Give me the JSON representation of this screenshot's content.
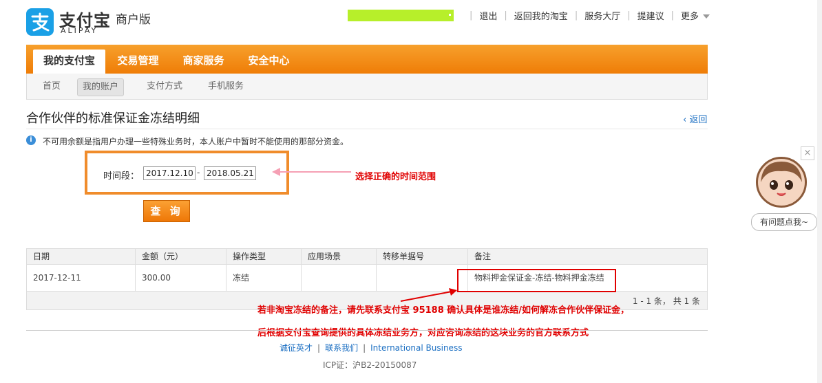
{
  "header": {
    "logo_cn": "支付宝",
    "logo_en": "ALIPAY",
    "logo_sub": "商户版",
    "links": [
      "退出",
      "返回我的淘宝",
      "服务大厅",
      "提建议",
      "更多"
    ]
  },
  "nav": {
    "main_tabs": [
      "我的支付宝",
      "交易管理",
      "商家服务",
      "安全中心"
    ],
    "sub_tabs": [
      "首页",
      "我的账户",
      "支付方式",
      "手机服务"
    ]
  },
  "page": {
    "title": "合作伙伴的标准保证金冻结明细",
    "back": "返回",
    "info": "不可用余额是指用户办理一些特殊业务时，本人账户中暂时不能使用的那部分资金。",
    "range_label": "时间段：",
    "date_from": "2017.12.10",
    "date_sep": "-",
    "date_to": "2018.05.21",
    "query_label": "查 询"
  },
  "table": {
    "headers": [
      "日期",
      "金额（元）",
      "操作类型",
      "应用场景",
      "转移单据号",
      "备注"
    ],
    "rows": [
      [
        "2017-12-11",
        "300.00",
        "冻结",
        "",
        "",
        "物料押金保证金-冻结-物料押金冻结"
      ]
    ],
    "pager": "1 - 1 条， 共 1 条"
  },
  "annotations": {
    "time_hint": "选择正确的时间范围",
    "note_line1": "若非淘宝冻结的备注，请先联系支付宝 95188 确认具体是谁冻结/如何解冻合作伙伴保证金，",
    "note_line2": "后根据支付宝查询提供的具体冻结业务方，对应咨询冻结的这块业务的官方联系方式"
  },
  "footer": {
    "links": [
      "诚征英才",
      "联系我们",
      "International Business"
    ],
    "icp": "ICP证：沪B2-20150087"
  },
  "helper": {
    "bubble": "有问题点我~",
    "close": "×"
  },
  "colors": {
    "brand_orange": "#ef7d07",
    "alipay_blue": "#1aa0e6",
    "link_blue": "#1a6ec2",
    "annotation_red": "#e00000"
  }
}
